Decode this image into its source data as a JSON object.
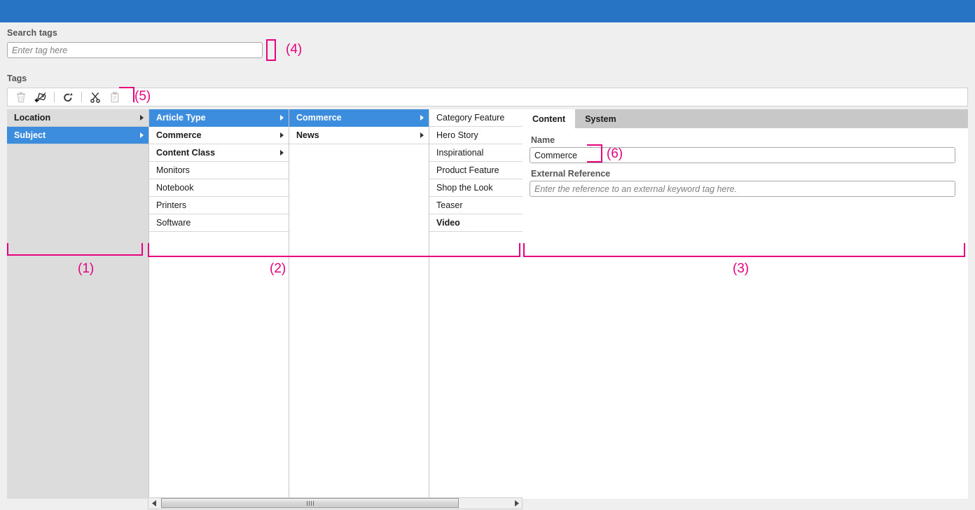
{
  "window": {
    "titlebar_color": "#2874c4"
  },
  "search": {
    "label": "Search tags",
    "placeholder": "Enter tag here",
    "value": ""
  },
  "tags_section": {
    "label": "Tags",
    "toolbar": {
      "buttons": [
        {
          "name": "delete-tag-button",
          "icon": "trash-icon",
          "enabled": false
        },
        {
          "name": "add-tag-button",
          "icon": "tag-plus-icon",
          "enabled": true
        },
        {
          "name": "refresh-button",
          "icon": "refresh-arrow-icon",
          "enabled": true
        },
        {
          "name": "cut-button",
          "icon": "scissors-icon",
          "enabled": true
        },
        {
          "name": "paste-button",
          "icon": "clipboard-icon",
          "enabled": false
        }
      ]
    }
  },
  "columns": [
    {
      "name": "column-root",
      "background": "grey",
      "items": [
        {
          "label": "Location",
          "bold": true,
          "selected": false,
          "has_children": true
        },
        {
          "label": "Subject",
          "bold": true,
          "selected": true,
          "has_children": true
        }
      ]
    },
    {
      "name": "column-subject",
      "background": "white",
      "items": [
        {
          "label": "Article Type",
          "bold": true,
          "selected": true,
          "has_children": true
        },
        {
          "label": "Commerce",
          "bold": true,
          "selected": false,
          "has_children": true
        },
        {
          "label": "Content Class",
          "bold": true,
          "selected": false,
          "has_children": true
        },
        {
          "label": "Monitors",
          "bold": false,
          "selected": false,
          "has_children": false
        },
        {
          "label": "Notebook",
          "bold": false,
          "selected": false,
          "has_children": false
        },
        {
          "label": "Printers",
          "bold": false,
          "selected": false,
          "has_children": false
        },
        {
          "label": "Software",
          "bold": false,
          "selected": false,
          "has_children": false
        }
      ]
    },
    {
      "name": "column-article-type",
      "background": "white",
      "items": [
        {
          "label": "Commerce",
          "bold": true,
          "selected": true,
          "has_children": true
        },
        {
          "label": "News",
          "bold": true,
          "selected": false,
          "has_children": true
        }
      ]
    },
    {
      "name": "column-commerce",
      "background": "white",
      "items": [
        {
          "label": "Category Feature",
          "bold": false,
          "selected": false,
          "has_children": false
        },
        {
          "label": "Hero Story",
          "bold": false,
          "selected": false,
          "has_children": false
        },
        {
          "label": "Inspirational",
          "bold": false,
          "selected": false,
          "has_children": false
        },
        {
          "label": "Product Feature",
          "bold": false,
          "selected": false,
          "has_children": false
        },
        {
          "label": "Shop the Look",
          "bold": false,
          "selected": false,
          "has_children": false
        },
        {
          "label": "Teaser",
          "bold": false,
          "selected": false,
          "has_children": false
        },
        {
          "label": "Video",
          "bold": true,
          "selected": false,
          "has_children": false
        }
      ]
    }
  ],
  "detail": {
    "tabs": [
      {
        "label": "Content",
        "active": true
      },
      {
        "label": "System",
        "active": false
      }
    ],
    "name_label": "Name",
    "name_value": "Commerce",
    "external_reference_label": "External Reference",
    "external_reference_placeholder": "Enter the reference to an external keyword tag here.",
    "external_reference_value": ""
  },
  "annotations": {
    "color": "#e6007e",
    "markers": [
      {
        "id": "1",
        "label": "(1)"
      },
      {
        "id": "2",
        "label": "(2)"
      },
      {
        "id": "3",
        "label": "(3)"
      },
      {
        "id": "4",
        "label": "(4)"
      },
      {
        "id": "5",
        "label": "(5)"
      },
      {
        "id": "6",
        "label": "(6)"
      }
    ]
  }
}
